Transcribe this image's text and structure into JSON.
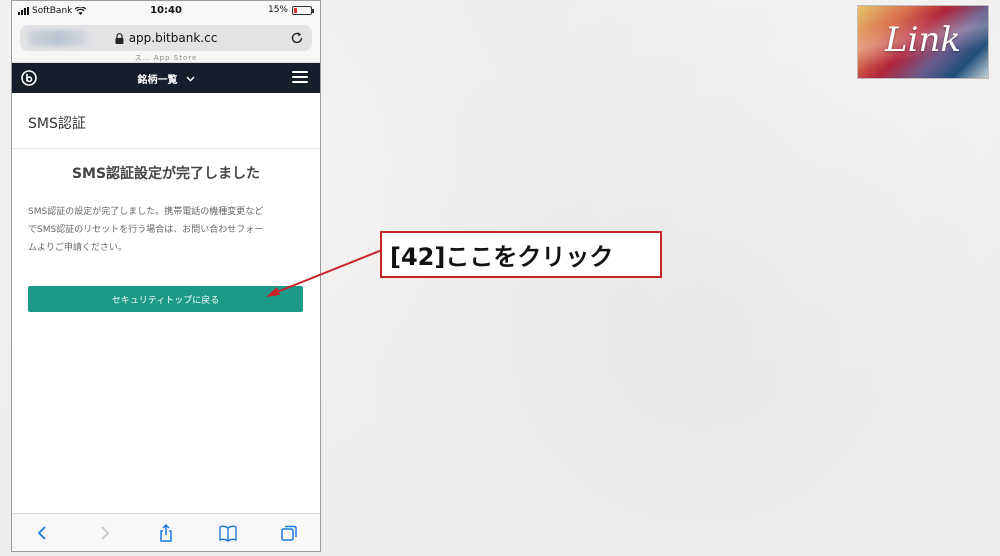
{
  "status_bar": {
    "carrier": "SoftBank",
    "time": "10:40",
    "battery": "15%",
    "battery_level": 0.15,
    "battery_color": "#e0312f"
  },
  "address_bar": {
    "url": "app.bitbank.cc",
    "subtext": "ス… App Store"
  },
  "site_nav": {
    "title": "銘柄一覧",
    "background": "#161d2b"
  },
  "page": {
    "heading": "SMS認証",
    "section_title": "SMS認証設定が完了しました",
    "body_lines": [
      "SMS認証の設定が完了しました。携帯電話の機種変更など",
      "でSMS認証のリセットを行う場合は、お問い合わせフォー",
      "ムよりご申請ください。"
    ],
    "button_label": "セキュリティトップに戻る",
    "button_color": "#1c9a87"
  },
  "toolbar": {
    "icons": [
      "back-arrow-icon",
      "forward-arrow-icon",
      "share-icon",
      "bookmarks-icon",
      "tabs-icon"
    ]
  },
  "annotation": {
    "label": "[42]ここをクリック",
    "border_color": "#c8232b"
  },
  "brand": {
    "text": "Link"
  }
}
